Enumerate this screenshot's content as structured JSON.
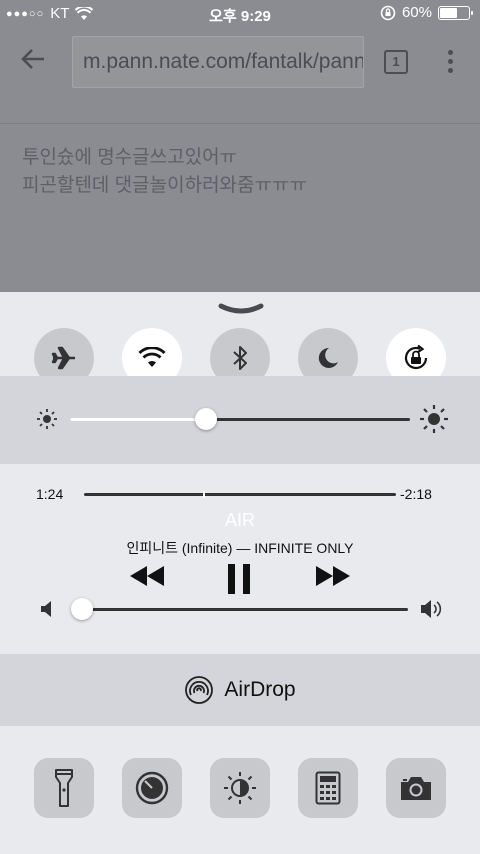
{
  "status_bar": {
    "carrier": "KT",
    "time": "오후 9:29",
    "battery_percent": "60%",
    "battery_level": 0.6
  },
  "browser": {
    "url": "m.pann.nate.com/fantalk/pann",
    "tab_count": "1",
    "post_lines": [
      "투인슜에 명수글쓰고있어ㅠ",
      "피곤할텐데 댓글놀이하러와줌ㅠㅠㅠ"
    ]
  },
  "control_center": {
    "toggles": [
      {
        "name": "airplane-mode",
        "on": false
      },
      {
        "name": "wifi",
        "on": true
      },
      {
        "name": "bluetooth",
        "on": false
      },
      {
        "name": "do-not-disturb",
        "on": false
      },
      {
        "name": "rotation-lock",
        "on": true
      }
    ],
    "brightness_level": 0.4,
    "music": {
      "elapsed": "1:24",
      "remaining": "-2:18",
      "progress": 0.38,
      "title": "AIR",
      "artist_album": "인피니트 (Infinite) — INFINITE ONLY"
    },
    "volume_level": 0.03,
    "airdrop_label": "AirDrop",
    "shortcuts": [
      "flashlight-icon",
      "timer-icon",
      "night-shift-icon",
      "calculator-icon",
      "camera-icon"
    ]
  }
}
